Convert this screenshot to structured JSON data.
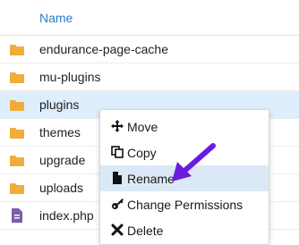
{
  "table": {
    "header_name": "Name"
  },
  "rows": [
    {
      "name": "endurance-page-cache",
      "type": "folder"
    },
    {
      "name": "mu-plugins",
      "type": "folder"
    },
    {
      "name": "plugins",
      "type": "folder"
    },
    {
      "name": "themes",
      "type": "folder"
    },
    {
      "name": "upgrade",
      "type": "folder"
    },
    {
      "name": "uploads",
      "type": "folder"
    },
    {
      "name": "index.php",
      "type": "file"
    }
  ],
  "context_menu": {
    "items": [
      {
        "label": "Move",
        "icon": "move-icon"
      },
      {
        "label": "Copy",
        "icon": "copy-icon"
      },
      {
        "label": "Rename",
        "icon": "file-icon"
      },
      {
        "label": "Change Permissions",
        "icon": "key-icon"
      },
      {
        "label": "Delete",
        "icon": "delete-icon"
      }
    ]
  },
  "colors": {
    "folder": "#f0ad3c",
    "file": "#7a5ea8",
    "header_text": "#2b7bd0",
    "selected_row": "#dfeefc",
    "arrow": "#6a1be0"
  }
}
